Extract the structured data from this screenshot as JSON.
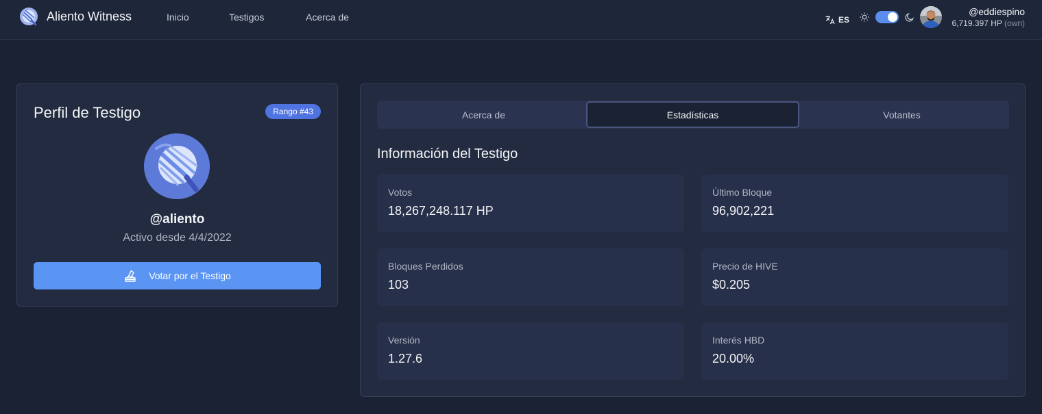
{
  "brand": {
    "name": "Aliento Witness"
  },
  "nav": {
    "items": [
      "Inicio",
      "Testigos",
      "Acerca de"
    ]
  },
  "header": {
    "language": "ES",
    "theme_toggle_on": true,
    "user": {
      "name": "@eddiespino",
      "hp": "6,719.397 HP",
      "hp_suffix": "(own)"
    }
  },
  "profile": {
    "title": "Perfil de Testigo",
    "rank_badge": "Rango #43",
    "witness_name": "@aliento",
    "active_since": "Activo desde 4/4/2022",
    "vote_button": "Votar por el Testigo"
  },
  "tabs": [
    {
      "label": "Acerca de",
      "active": false
    },
    {
      "label": "Estadísticas",
      "active": true
    },
    {
      "label": "Votantes",
      "active": false
    }
  ],
  "stats": {
    "title": "Información del Testigo",
    "items": [
      {
        "label": "Votos",
        "value": "18,267,248.117 HP"
      },
      {
        "label": "Último Bloque",
        "value": "96,902,221"
      },
      {
        "label": "Bloques Perdidos",
        "value": "103"
      },
      {
        "label": "Precio de HIVE",
        "value": "$0.205"
      },
      {
        "label": "Versión",
        "value": "1.27.6"
      },
      {
        "label": "Interés HBD",
        "value": "20.00%"
      }
    ]
  },
  "colors": {
    "accent": "#5b95f3",
    "badge": "#4f73e0",
    "background": "#1b2234",
    "card": "#222b40"
  }
}
